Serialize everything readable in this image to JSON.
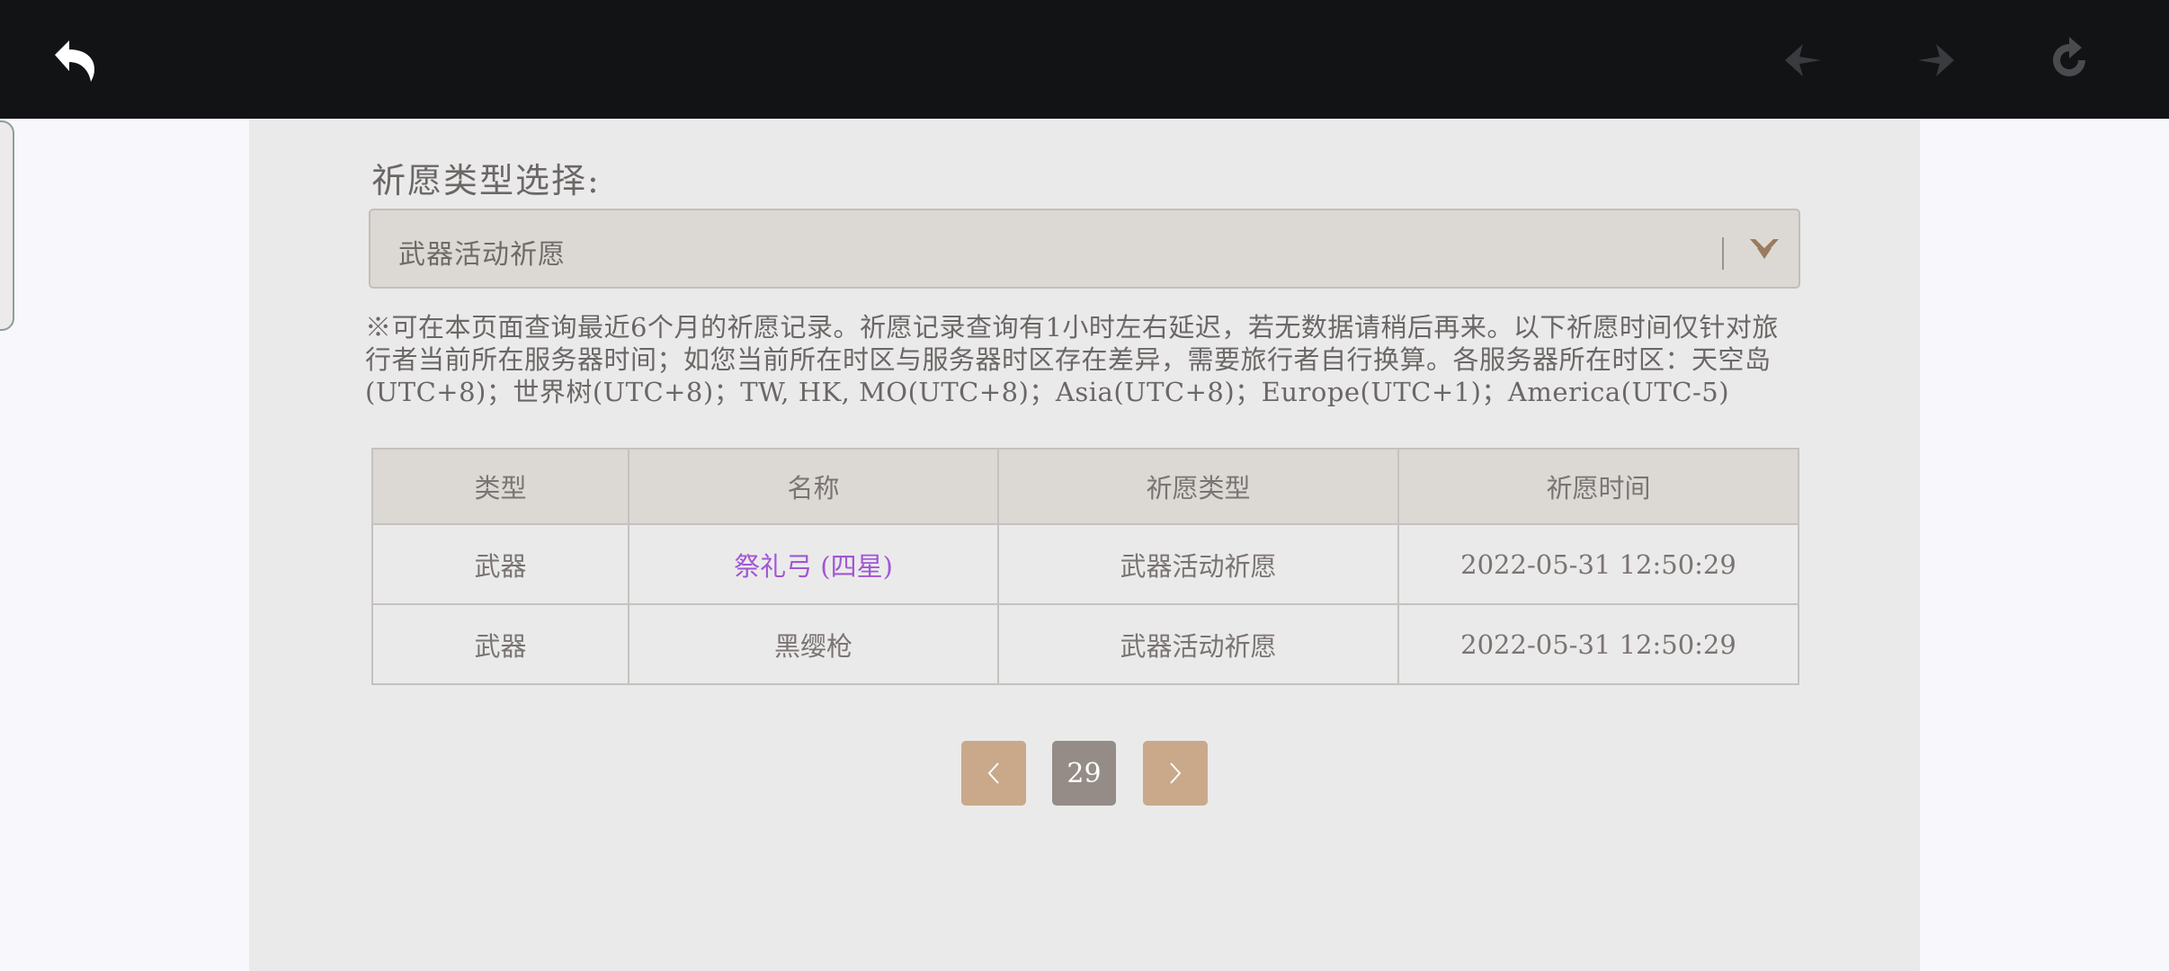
{
  "topbar": {
    "back_icon": "back-arrow-icon",
    "nav_back_icon": "nav-back-icon",
    "nav_forward_icon": "nav-forward-icon",
    "refresh_icon": "refresh-icon"
  },
  "selector": {
    "label": "祈愿类型选择:",
    "value": "武器活动祈愿"
  },
  "notice": "※可在本页面查询最近6个月的祈愿记录。祈愿记录查询有1小时左右延迟，若无数据请稍后再来。以下祈愿时间仅针对旅行者当前所在服务器时间；如您当前所在时区与服务器时区存在差异，需要旅行者自行换算。各服务器所在时区：天空岛(UTC+8)；世界树(UTC+8)；TW, HK, MO(UTC+8)；Asia(UTC+8)；Europe(UTC+1)；America(UTC-5)",
  "table": {
    "headers": [
      "类型",
      "名称",
      "祈愿类型",
      "祈愿时间"
    ],
    "rows": [
      {
        "type": "武器",
        "name": "祭礼弓 (四星)",
        "wish_type": "武器活动祈愿",
        "time": "2022-05-31 12:50:29"
      },
      {
        "type": "武器",
        "name": "黑缨枪",
        "wish_type": "武器活动祈愿",
        "time": "2022-05-31 12:50:29"
      }
    ]
  },
  "pagination": {
    "current_page": "29"
  },
  "colors": {
    "rare_item": "#a156d6",
    "accent_button": "#c9a98a",
    "topbar": "#121315"
  }
}
